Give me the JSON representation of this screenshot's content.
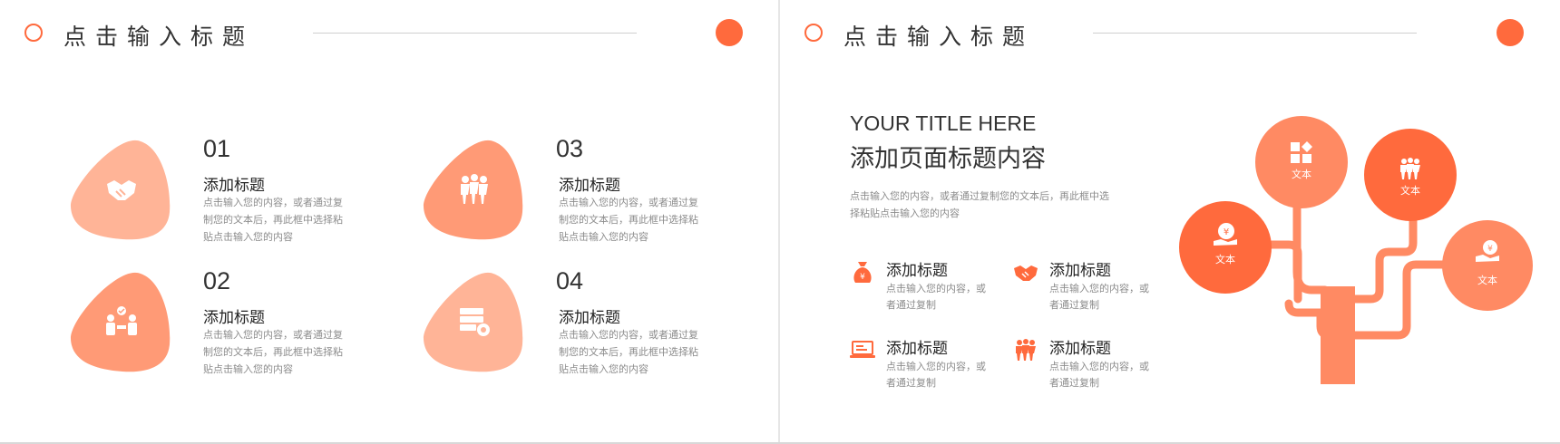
{
  "colors": {
    "accent": "#ff6a3d",
    "light": "#ffb497",
    "mid": "#ff9a76",
    "dark": "#ff7e55"
  },
  "left": {
    "header_title": "点击输入标题",
    "items": [
      {
        "num": "01",
        "title": "添加标题",
        "desc": "点击输入您的内容，或者通过复制您的文本后，再此框中选择粘贴点击输入您的内容",
        "icon": "handshake-icon"
      },
      {
        "num": "02",
        "title": "添加标题",
        "desc": "点击输入您的内容，或者通过复制您的文本后，再此框中选择粘贴点击输入您的内容",
        "icon": "team-check-icon"
      },
      {
        "num": "03",
        "title": "添加标题",
        "desc": "点击输入您的内容，或者通过复制您的文本后，再此框中选择粘贴点击输入您的内容",
        "icon": "people-group-icon"
      },
      {
        "num": "04",
        "title": "添加标题",
        "desc": "点击输入您的内容，或者通过复制您的文本后，再此框中选择粘贴点击输入您的内容",
        "icon": "server-gear-icon"
      }
    ]
  },
  "right": {
    "header_title": "点击输入标题",
    "en_title": "YOUR TITLE HERE",
    "cn_title": "添加页面标题内容",
    "desc": "点击输入您的内容，或者通过复制您的文本后，再此框中选择粘贴点击输入您的内容",
    "features": [
      {
        "title": "添加标题",
        "desc": "点击输入您的内容，或者通过复制",
        "icon": "money-bag-icon"
      },
      {
        "title": "添加标题",
        "desc": "点击输入您的内容，或者通过复制",
        "icon": "handshake-icon"
      },
      {
        "title": "添加标题",
        "desc": "点击输入您的内容，或者通过复制",
        "icon": "laptop-icon"
      },
      {
        "title": "添加标题",
        "desc": "点击输入您的内容，或者通过复制",
        "icon": "people-group-icon"
      }
    ],
    "tree": [
      {
        "label": "文本",
        "icon": "coin-hand-icon"
      },
      {
        "label": "文本",
        "icon": "grid-icon"
      },
      {
        "label": "文本",
        "icon": "people-group-icon"
      },
      {
        "label": "文本",
        "icon": "money-hand-icon"
      }
    ]
  }
}
